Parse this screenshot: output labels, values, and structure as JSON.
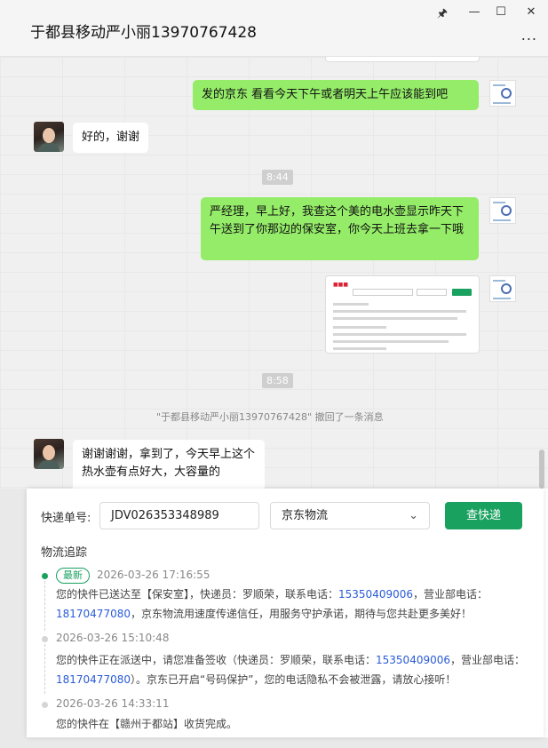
{
  "window": {
    "title": "于都县移动严小丽13970767428",
    "more": "..."
  },
  "chat": {
    "msg1": "发的京东  看看今天下午或者明天上午应该能到吧",
    "msg2": "好的，谢谢",
    "time1": "8:44",
    "msg3": "严经理，早上好，我查这个美的电水壶显示昨天下午送到了你那边的保安室，你今天上班去拿一下哦",
    "time2": "8:58",
    "recall": "\"于都县移动严小丽13970767428\" 撤回了一条消息",
    "msg4": "谢谢谢谢，拿到了，今天早上这个热水壶有点好大，大容量的"
  },
  "tracker": {
    "label": "快递单号:",
    "number": "JDV026353348989",
    "carrier": "京东物流",
    "query_button": "查快递",
    "section_title": "物流追踪",
    "latest_badge": "最新",
    "events": [
      {
        "date": "2026-03-26 17:16:55",
        "t1": "您的快件已送达至【保安室】，快递员：罗顺荣，联系电话：",
        "p1": "15350409006",
        "t2": "，营业部电话：",
        "p2": "18170477080",
        "t3": "，京东物流用速度传递信任，用服务守护承诺，期待与您共赴更多美好！"
      },
      {
        "date": "2026-03-26 15:10:48",
        "t1": "您的快件正在派送中，请您准备签收（快递员：罗顺荣，联系电话：",
        "p1": "15350409006",
        "t2": "，营业部电话：",
        "p2": "18170477080",
        "t3": "）。京东已开启“号码保护”，您的电话隐私不会被泄露，请放心接听！"
      },
      {
        "date": "2026-03-26 14:33:11",
        "t1": "您的快件在【赣州于都站】收货完成。"
      }
    ]
  },
  "colors": {
    "accent": "#19a15f",
    "bubble_out": "#95ec69",
    "phone_link": "#2a5bd7"
  }
}
